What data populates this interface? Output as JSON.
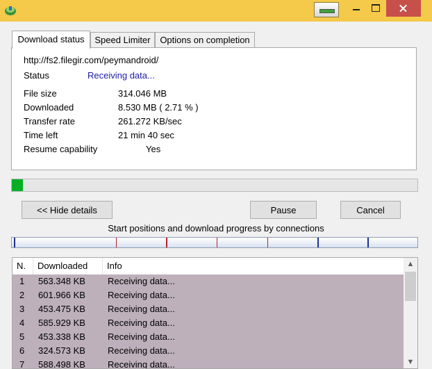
{
  "colors": {
    "titlebar": "#f5c949",
    "accent_blue": "#1a1aa6",
    "progress_green": "#06b025",
    "row_selected": "#bdb0bb"
  },
  "icons": [
    "app-download-icon",
    "minimize-icon",
    "maximize-icon",
    "close-icon",
    "scroll-up-icon",
    "scroll-down-icon"
  ],
  "tabs": [
    "Download status",
    "Speed Limiter",
    "Options on completion"
  ],
  "status": {
    "url": "http://fs2.filegir.com/peymandroid/",
    "status_label": "Status",
    "status_value": "Receiving data...",
    "file_size_label": "File size",
    "file_size_value": "314.046  MB",
    "downloaded_label": "Downloaded",
    "downloaded_value": "8.530  MB  ( 2.71 % )",
    "transfer_rate_label": "Transfer rate",
    "transfer_rate_value": "261.272  KB/sec",
    "time_left_label": "Time left",
    "time_left_value": "21 min 40 sec",
    "resume_label": "Resume capability",
    "resume_value": "Yes"
  },
  "progress_fraction": 0.0271,
  "buttons": {
    "hide_details": "<< Hide details",
    "pause": "Pause",
    "cancel": "Cancel"
  },
  "connections_label": "Start positions and download progress by connections",
  "connections": {
    "headers": [
      "N.",
      "Downloaded",
      "Info"
    ],
    "rows": [
      {
        "n": "1",
        "downloaded": "563.348  KB",
        "info": "Receiving data..."
      },
      {
        "n": "2",
        "downloaded": "601.966  KB",
        "info": "Receiving data..."
      },
      {
        "n": "3",
        "downloaded": "453.475  KB",
        "info": "Receiving data..."
      },
      {
        "n": "4",
        "downloaded": "585.929  KB",
        "info": "Receiving data..."
      },
      {
        "n": "5",
        "downloaded": "453.338  KB",
        "info": "Receiving data..."
      },
      {
        "n": "6",
        "downloaded": "324.573  KB",
        "info": "Receiving data..."
      },
      {
        "n": "7",
        "downloaded": "588.498  KB",
        "info": "Receiving data..."
      }
    ]
  }
}
